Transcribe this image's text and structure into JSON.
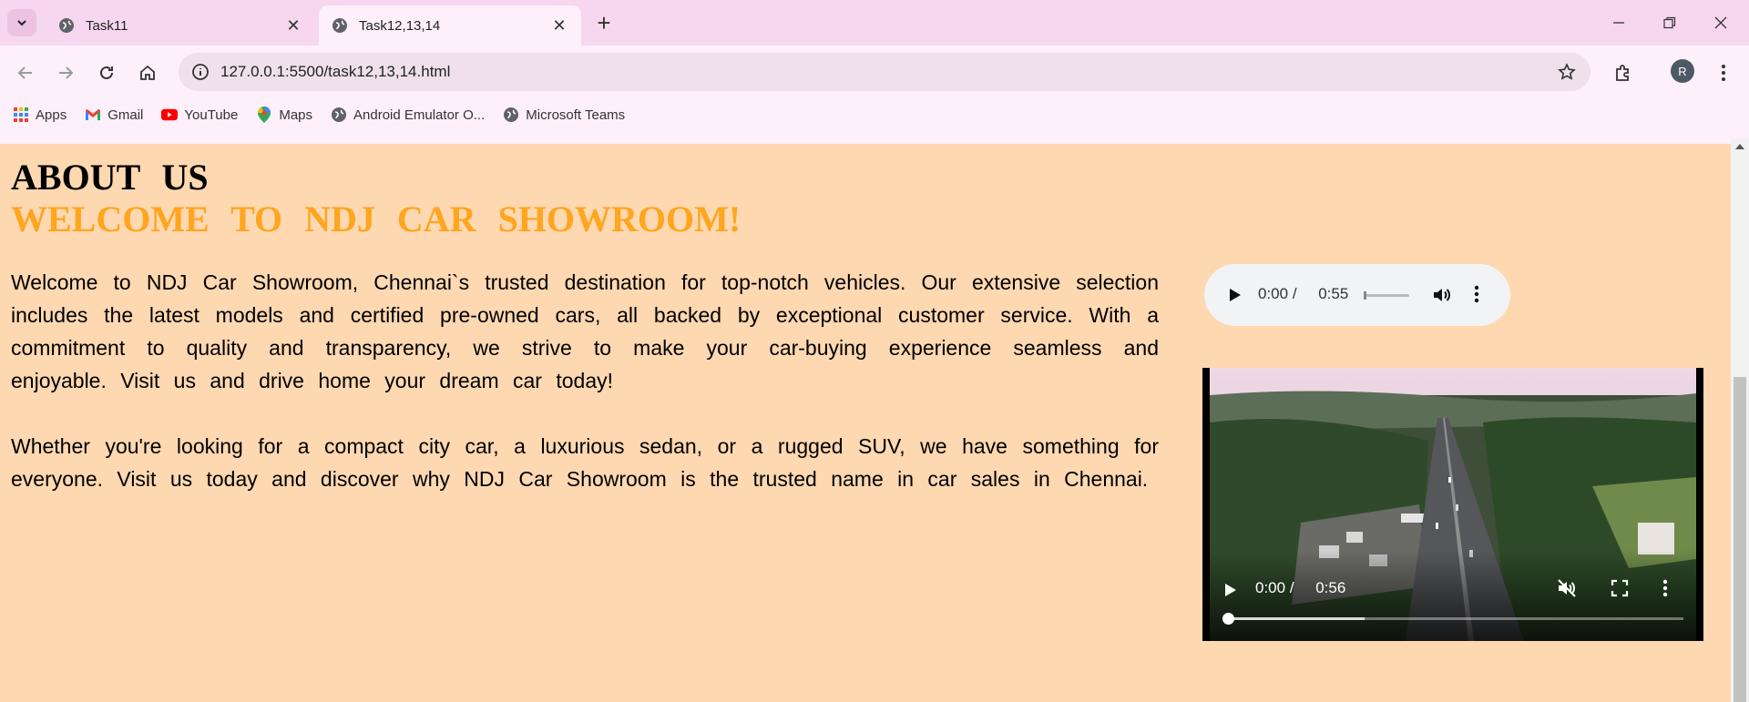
{
  "browser": {
    "tabs": [
      {
        "title": "Task11",
        "active": false
      },
      {
        "title": "Task12,13,14",
        "active": true
      }
    ],
    "url": "127.0.0.1:5500/task12,13,14.html",
    "profile_initial": "R",
    "bookmarks": [
      {
        "label": "Apps",
        "icon": "apps-grid-icon"
      },
      {
        "label": "Gmail",
        "icon": "gmail-icon"
      },
      {
        "label": "YouTube",
        "icon": "youtube-icon"
      },
      {
        "label": "Maps",
        "icon": "maps-pin-icon"
      },
      {
        "label": "Android Emulator O...",
        "icon": "globe-icon"
      },
      {
        "label": "Microsoft Teams",
        "icon": "globe-icon"
      }
    ]
  },
  "page": {
    "heading": "ABOUT US",
    "subheading": "WELCOME TO NDJ CAR SHOWROOM!",
    "paragraphs": [
      "Welcome to NDJ Car Showroom, Chennai`s trusted destination for top-notch vehicles. Our extensive selection includes the latest models and certified pre-owned cars, all backed by exceptional customer service. With a commitment to quality and transparency, we strive to make your car-buying experience seamless and enjoyable. Visit us and drive home your dream car today!",
      "Whether you're looking for a compact city car, a luxurious sedan, or a rugged SUV, we have something for everyone. Visit us today and discover why NDJ Car Showroom is the trusted name in car sales in Chennai."
    ],
    "audio": {
      "current": "0:00",
      "separator": "/",
      "duration": "0:55"
    },
    "video": {
      "current": "0:00",
      "separator": "/",
      "duration": "0:56",
      "buffered_fraction": 0.3,
      "muted": true
    }
  },
  "colors": {
    "page_background": "#fed8b1",
    "subheading": "#ffa51e",
    "tabstrip": "#f6d7ef",
    "toolbar": "#fdf0fa"
  }
}
